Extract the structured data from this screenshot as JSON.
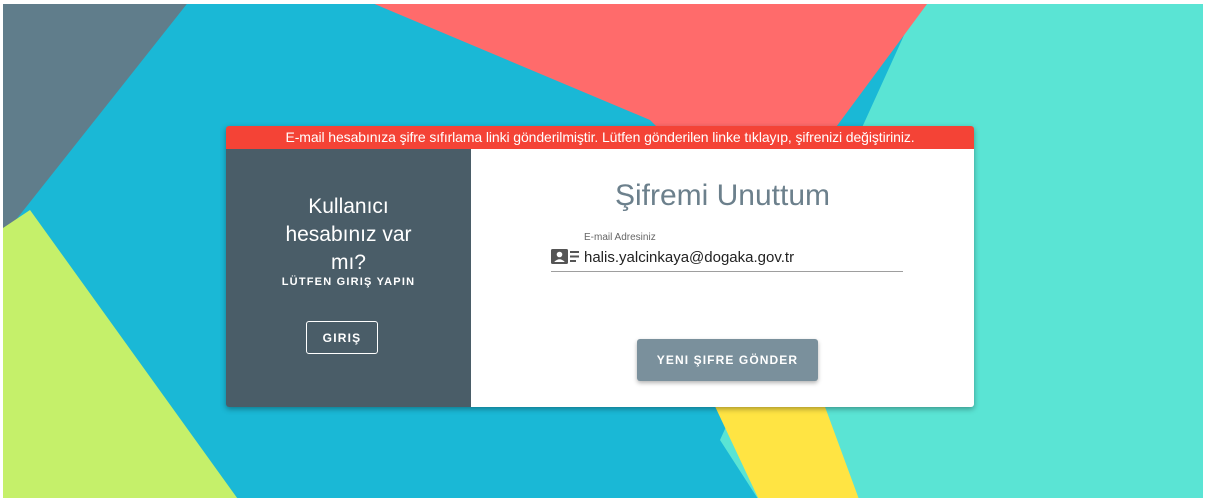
{
  "colors": {
    "alert_bg": "#f44336",
    "left_panel_bg": "#4a5d68",
    "title_color": "#6c808c",
    "button_bg": "#7a909c",
    "bg_cyan": "#1ab8d6",
    "bg_coral": "#ff6b6b",
    "bg_turquoise": "#5ae4d4",
    "bg_slate": "#607d8b",
    "bg_lime": "#c5f06a",
    "bg_yellow": "#ffe443"
  },
  "alert": {
    "message": "E-mail hesabınıza şifre sıfırlama linki gönderilmiştir. Lütfen gönderilen linke tıklayıp, şifrenizi değiştiriniz."
  },
  "left_panel": {
    "title": "Kullanıcı hesabınız var mı?",
    "subtitle": "LÜTFEN GIRIŞ YAPIN",
    "login_button": "GIRIŞ"
  },
  "form": {
    "title": "Şifremi Unuttum",
    "email_label": "E-mail Adresiniz",
    "email_value": "halis.yalcinkaya@dogaka.gov.tr",
    "email_icon": "contact-card-icon",
    "submit_button": "YENI ŞIFRE GÖNDER"
  }
}
